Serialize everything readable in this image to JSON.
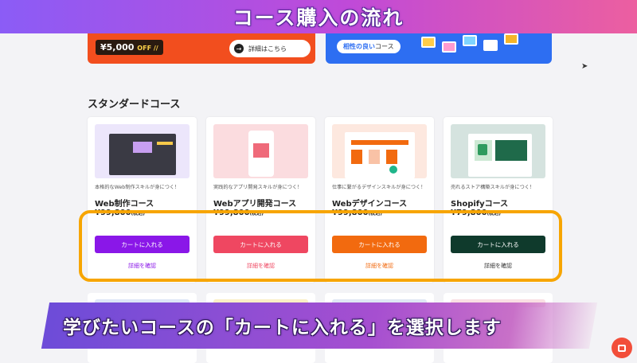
{
  "title_overlay": "コース購入の流れ",
  "promo_left": {
    "price": "¥5,000",
    "price_suffix": "OFF //",
    "button_label": "詳細はこちら"
  },
  "promo_right": {
    "pill_strong": "相性の良い",
    "pill_rest": "コース"
  },
  "section_title": "スタンダードコース",
  "courses": [
    {
      "tagline": "本格的なWeb制作スキルが身につく！",
      "name": "Web制作コース",
      "price": "¥99,800",
      "tax": "(税込)",
      "cart_label": "カートに入れる",
      "detail_label": "詳細を確認",
      "color": "#8a17e8",
      "thumb_bg": "#ece6fb"
    },
    {
      "tagline": "実践的なアプリ開発スキルが身につく！",
      "name": "Webアプリ開発コース",
      "price": "¥99,800",
      "tax": "(税込)",
      "cart_label": "カートに入れる",
      "detail_label": "詳細を確認",
      "color": "#ef4761",
      "thumb_bg": "#fbdcdf"
    },
    {
      "tagline": "仕事に繋がるデザインスキルが身につく！",
      "name": "Webデザインコース",
      "price": "¥99,800",
      "tax": "(税込)",
      "cart_label": "カートに入れる",
      "detail_label": "詳細を確認",
      "color": "#f26a0f",
      "thumb_bg": "#fde8df"
    },
    {
      "tagline": "売れるストア構築スキルが身につく！",
      "name": "Shopifyコース",
      "price": "¥79,800",
      "tax": "(税込)",
      "cart_label": "カートに入れる",
      "detail_label": "詳細を確認",
      "color": "#0f3a2c",
      "thumb_bg": "#d5e3df"
    }
  ],
  "caption_overlay": "学びたいコースの「カートに入れる」を選択します",
  "colors": {
    "highlight": "#f7a500",
    "chat": "#f24e3a"
  }
}
